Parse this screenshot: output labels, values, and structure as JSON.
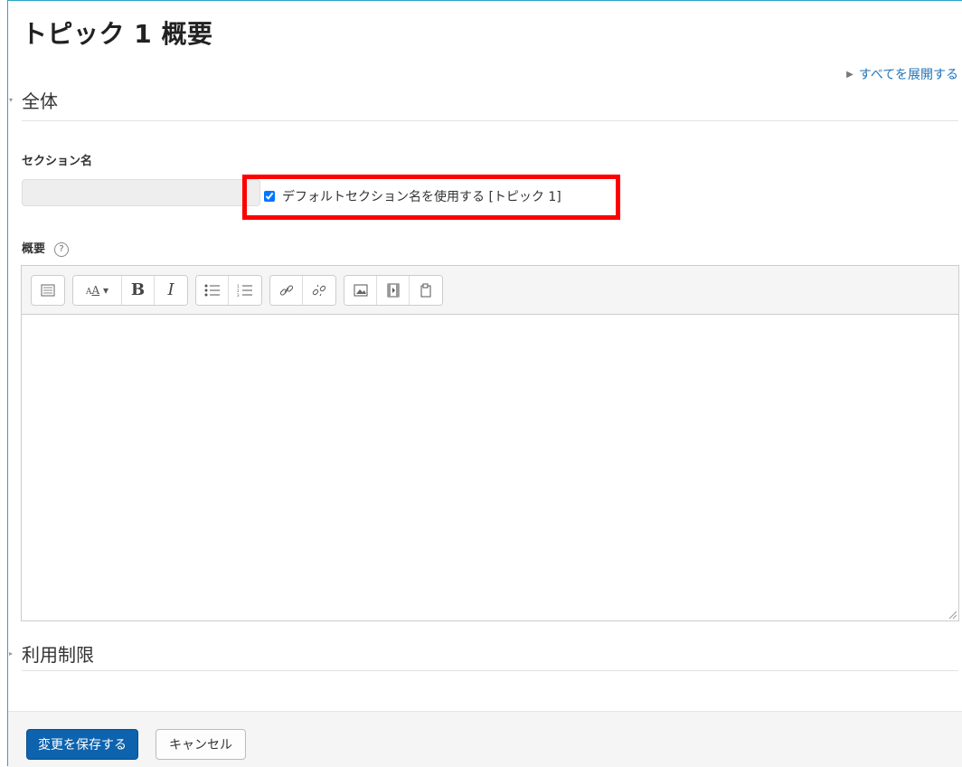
{
  "page": {
    "title": "トピック 1 概要"
  },
  "expand_all": {
    "label": "すべてを展開する"
  },
  "sections": {
    "general": {
      "label": "全体"
    },
    "restrictions": {
      "label": "利用制限"
    }
  },
  "form": {
    "section_name": {
      "label": "セクション名",
      "value": "",
      "default_checkbox_label": "デフォルトセクション名を使用する [トピック 1]",
      "default_checked": true
    },
    "summary": {
      "label": "概要",
      "help": "?"
    }
  },
  "toolbar": {
    "icons": [
      "show-more-icon",
      "font-style-icon",
      "bold-icon",
      "italic-icon",
      "unordered-list-icon",
      "ordered-list-icon",
      "link-icon",
      "unlink-icon",
      "image-icon",
      "media-icon",
      "file-icon"
    ],
    "bold_label": "B",
    "italic_label": "I"
  },
  "buttons": {
    "save": "変更を保存する",
    "cancel": "キャンセル"
  },
  "colors": {
    "frame": "#2aa3c7",
    "link": "#1f73b7",
    "primary_button": "#0d63ad",
    "highlight": "#ff0000"
  }
}
